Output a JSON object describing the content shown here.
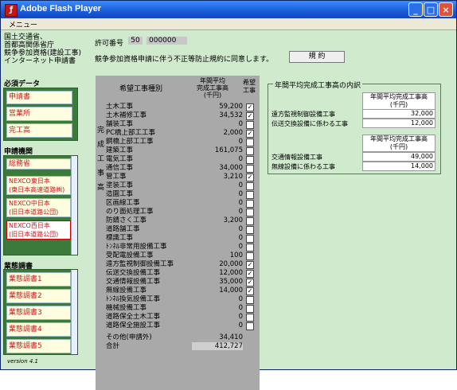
{
  "window": {
    "title": "Adobe Flash Player",
    "menu": "メニュー"
  },
  "header": {
    "org_lines": [
      "国土交通省、",
      "首都高関係省庁",
      "競争参加資格(建設工事)",
      "インターネット申請書"
    ],
    "permit_label": "許可番号",
    "permit_prefix": "50",
    "permit_no": "000000",
    "agree_text": "競争参加資格申請に伴う不正等防止規約に同意します。",
    "agree_button": "規 約"
  },
  "required": {
    "title": "必須データ",
    "items": [
      "申請書",
      "営業所",
      "完工高"
    ]
  },
  "agencies": {
    "title": "申請機関",
    "items": [
      "総務省",
      "NEXCO東日本\n(東日本高速道路㈱)",
      "NEXCO中日本\n(旧日本道路公団)",
      "NEXCO西日本\n(旧日本道路公団)"
    ]
  },
  "surveys": {
    "title": "業態調書",
    "items": [
      "業態調書1",
      "業態調書2",
      "業態調書3",
      "業態調書4",
      "業態調書5"
    ]
  },
  "version": "version 4.1",
  "table": {
    "h_type": "希望工事種別",
    "h_amount": "年間平均\n完成工事高\n(千円)",
    "h_wish": "希望\n工事",
    "side_label": "完成工事高",
    "rows": [
      {
        "name": "土木工事",
        "value": "59,200",
        "checked": true
      },
      {
        "name": "土木補修工事",
        "value": "34,532",
        "checked": true
      },
      {
        "name": "舗装工事",
        "value": "0",
        "checked": false
      },
      {
        "name": "PC橋上部工工事",
        "value": "2,000",
        "checked": true
      },
      {
        "name": "鋼橋上部工工事",
        "value": "0",
        "checked": false
      },
      {
        "name": "建築工事",
        "value": "161,075",
        "checked": false
      },
      {
        "name": "電気工事",
        "value": "0",
        "checked": false
      },
      {
        "name": "通信工事",
        "value": "34,000",
        "checked": false
      },
      {
        "name": "管工事",
        "value": "3,210",
        "checked": true
      },
      {
        "name": "塗装工事",
        "value": "0",
        "checked": false
      },
      {
        "name": "造園工事",
        "value": "0",
        "checked": false
      },
      {
        "name": "区画線工事",
        "value": "0",
        "checked": false
      },
      {
        "name": "のり面処理工事",
        "value": "0",
        "checked": false
      },
      {
        "name": "防錆さく工事",
        "value": "3,200",
        "checked": false
      },
      {
        "name": "道路舗工事",
        "value": "0",
        "checked": false
      },
      {
        "name": "標識工事",
        "value": "0",
        "checked": false
      },
      {
        "name": "ﾄﾝﾈﾙ非常用設備工事",
        "value": "0",
        "checked": false
      },
      {
        "name": "受配電設備工事",
        "value": "100",
        "checked": false
      },
      {
        "name": "遠方監視制御設備工事",
        "value": "20,000",
        "checked": true
      },
      {
        "name": "伝送交換設備工事",
        "value": "12,000",
        "checked": true
      },
      {
        "name": "交通情報設備工事",
        "value": "35,000",
        "checked": true
      },
      {
        "name": "無線設備工事",
        "value": "14,000",
        "checked": true
      },
      {
        "name": "ﾄﾝﾈﾙ換気設備工事",
        "value": "0",
        "checked": false
      },
      {
        "name": "機械設備工事",
        "value": "0",
        "checked": false
      },
      {
        "name": "道路保全土木工事",
        "value": "0",
        "checked": false
      },
      {
        "name": "道路保全施設工事",
        "value": "0",
        "checked": false
      }
    ],
    "other_label": "その他(申請外)",
    "other_value": "34,410",
    "total_label": "合計",
    "total_value": "412,727"
  },
  "breakdown": {
    "title": "年間平均完成工事高の内訳",
    "header": "年間平均完成工事高\n(千円)",
    "group1": [
      {
        "name": "遠方監視制御設備工事",
        "value": "32,000"
      },
      {
        "name": "伝送交換設備に係わる工事",
        "value": "12,000"
      }
    ],
    "group2": [
      {
        "name": "交通情報設備工事",
        "value": "49,000"
      },
      {
        "name": "無線設備に係わる工事",
        "value": "14,000"
      }
    ]
  }
}
